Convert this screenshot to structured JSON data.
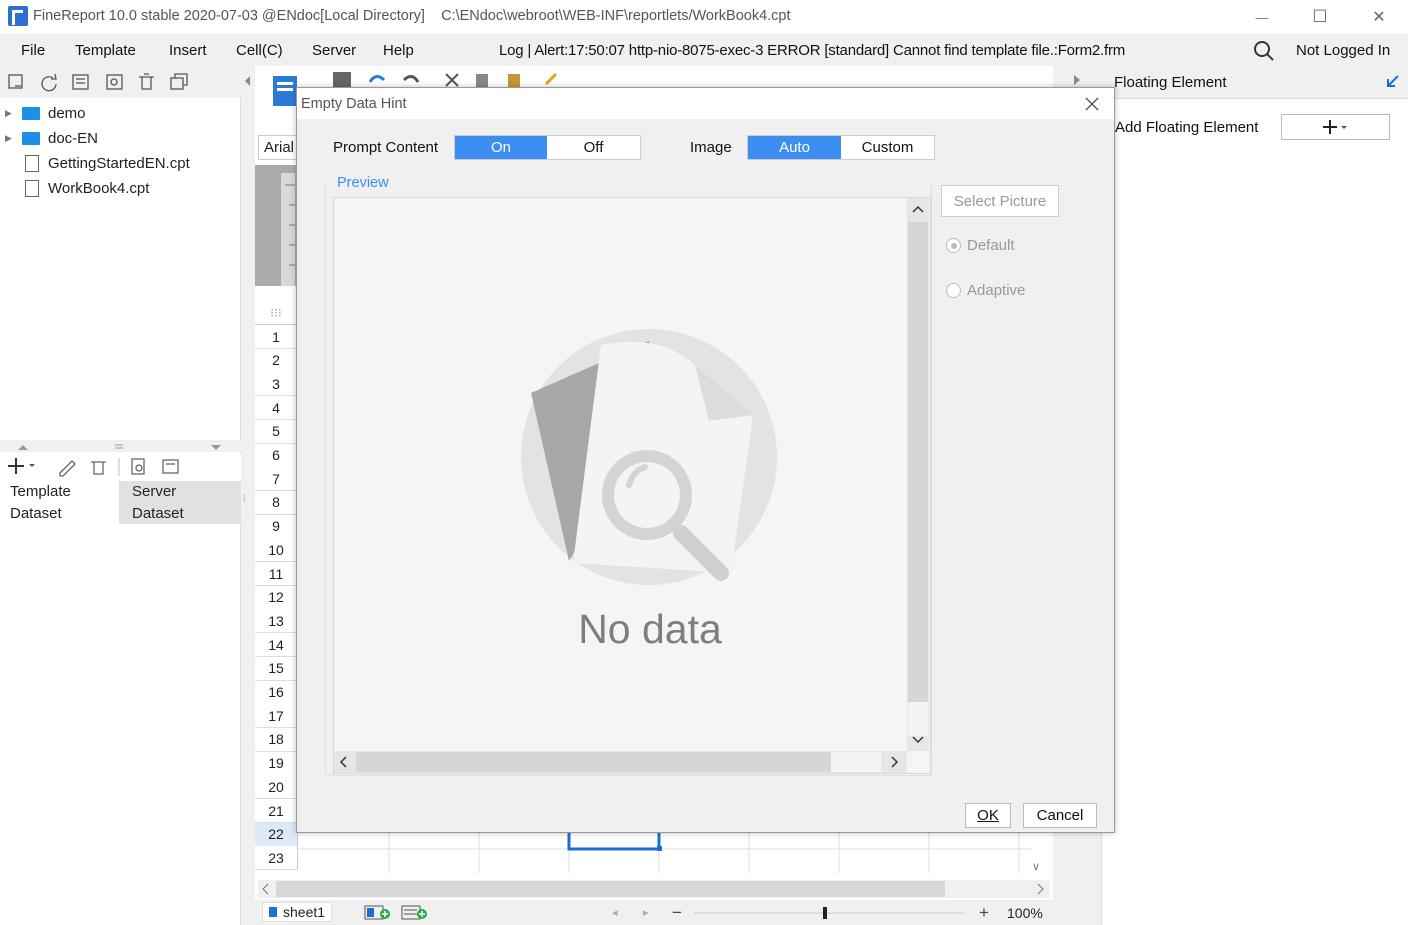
{
  "window": {
    "title": "FineReport 10.0 stable 2020-07-03 @ENdoc[Local Directory]",
    "path": "C:\\ENdoc\\webroot\\WEB-INF\\reportlets/WorkBook4.cpt",
    "minimize": "—",
    "maximize": "☐",
    "close": "✕"
  },
  "menu": {
    "items": [
      "File",
      "Template",
      "Insert",
      "Cell(C)",
      "Server",
      "Help"
    ],
    "log": "Log | Alert:17:50:07 http-nio-8075-exec-3 ERROR [standard] Cannot find template file.:Form2.frm",
    "user": "Not Logged In"
  },
  "tree": {
    "items": [
      {
        "label": "demo",
        "type": "folder"
      },
      {
        "label": "doc-EN",
        "type": "folder"
      },
      {
        "label": "GettingStartedEN.cpt",
        "type": "file"
      },
      {
        "label": "WorkBook4.cpt",
        "type": "file"
      }
    ]
  },
  "dataset": {
    "tab1_line1": "Template",
    "tab1_line2": "Dataset",
    "tab2_line1": "Server",
    "tab2_line2": "Dataset"
  },
  "editor": {
    "font": "Arial",
    "rows": [
      "1",
      "2",
      "3",
      "4",
      "5",
      "6",
      "7",
      "8",
      "9",
      "10",
      "11",
      "12",
      "13",
      "14",
      "15",
      "16",
      "17",
      "18",
      "19",
      "20",
      "21",
      "22",
      "23"
    ],
    "sheet": "sheet1",
    "zoom": "100%"
  },
  "rightpane": {
    "title": "Floating Element",
    "add_label": "Add Floating Element"
  },
  "dialog": {
    "title": "Empty Data Hint",
    "prompt_label": "Prompt Content",
    "prompt_on": "On",
    "prompt_off": "Off",
    "image_label": "Image",
    "image_auto": "Auto",
    "image_custom": "Custom",
    "preview_label": "Preview",
    "preview_text": "No data",
    "select_picture": "Select Picture",
    "radio_default": "Default",
    "radio_adaptive": "Adaptive",
    "ok": "OK",
    "cancel": "Cancel"
  },
  "colors": {
    "accent": "#3c8ff0",
    "folder": "#1e8fe6",
    "selection": "#1a6ed8"
  }
}
